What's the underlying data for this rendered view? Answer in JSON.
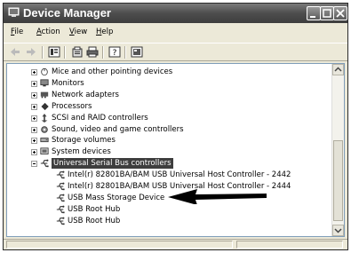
{
  "window": {
    "title": "Device Manager"
  },
  "menu": [
    "File",
    "Action",
    "View",
    "Help"
  ],
  "toolbar_icons": [
    "back-icon",
    "forward-icon",
    "properties-view-icon",
    "properties-icon",
    "print-icon",
    "help-icon",
    "scan-hardware-icon"
  ],
  "tree": [
    {
      "label": "Mice and other pointing devices",
      "expanded": false,
      "icon": "mouse-icon"
    },
    {
      "label": "Monitors",
      "expanded": false,
      "icon": "monitor-icon"
    },
    {
      "label": "Network adapters",
      "expanded": false,
      "icon": "network-adapter-icon"
    },
    {
      "label": "Processors",
      "expanded": false,
      "icon": "processor-icon"
    },
    {
      "label": "SCSI and RAID controllers",
      "expanded": false,
      "icon": "scsi-controller-icon"
    },
    {
      "label": "Sound, video and game controllers",
      "expanded": false,
      "icon": "sound-icon"
    },
    {
      "label": "Storage volumes",
      "expanded": false,
      "icon": "storage-volume-icon"
    },
    {
      "label": "System devices",
      "expanded": false,
      "icon": "system-device-icon"
    },
    {
      "label": "Universal Serial Bus controllers",
      "expanded": true,
      "selected": true,
      "icon": "usb-icon",
      "children": [
        "Intel(r) 82801BA/BAM USB Universal Host Controller - 2442",
        "Intel(r) 82801BA/BAM USB Universal Host Controller - 2444",
        "USB Mass Storage Device",
        "USB Root Hub",
        "USB Root Hub"
      ]
    }
  ]
}
